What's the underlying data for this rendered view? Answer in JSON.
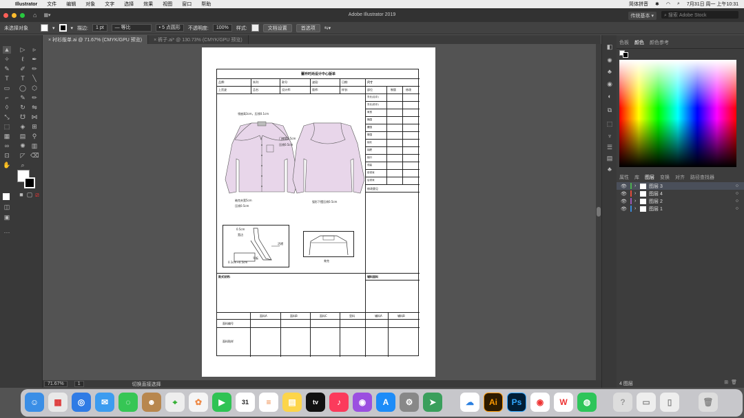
{
  "menubar": {
    "apple": "",
    "app": "Illustrator",
    "items": [
      "文件",
      "编辑",
      "对象",
      "文字",
      "选择",
      "效果",
      "视图",
      "窗口",
      "帮助"
    ],
    "input_method": "简体拼音",
    "clock": "7月31日 周一 上午10:31"
  },
  "titlebar": {
    "title": "Adobe Illustrator 2019",
    "workspace": "传统基本",
    "search_placeholder": "搜索 Adobe Stock"
  },
  "control": {
    "selection": "未选择对象",
    "stroke_label": "描边:",
    "stroke_value": "1 pt",
    "stroke_profile": "等比",
    "brush": "5 点圆形",
    "opacity_label": "不透明度:",
    "opacity_value": "100%",
    "style_label": "样式:",
    "doc_setup": "文档设置",
    "prefs": "首选项"
  },
  "tabs": [
    {
      "label": "衬衫版单.ai @ 71.67% (CMYK/GPU 预览)"
    },
    {
      "label": "裤子.ai* @ 130.73% (CMYK/GPU 预览)"
    }
  ],
  "status": {
    "zoom": "71.67%",
    "artboard": "1",
    "tool": "切换直接选择"
  },
  "panel": {
    "color_tabs": [
      "色板",
      "颜色",
      "颜色参考"
    ],
    "layer_tabs": [
      "属性",
      "库",
      "图层",
      "变换",
      "对齐",
      "路径查找器"
    ],
    "layers": [
      "图层 3",
      "图层 4",
      "图层 2",
      "图层 1"
    ],
    "layer_count": "4 图层",
    "layer_colors": [
      "#4caf50",
      "#e74c3c",
      "#9b59b6",
      "#3b8bd8"
    ]
  },
  "sheet": {
    "title": "蕾衿时尚设计中心版单",
    "r1": [
      "品牌:",
      "系列:",
      "款号:",
      "波段:",
      "日期:"
    ],
    "r2": [
      "上货波",
      "品名:",
      "设计师:",
      "版师:",
      "样衣:"
    ],
    "size_title": "尺寸",
    "size_head": [
      "部位",
      "制版",
      "修改"
    ],
    "size_rows": [
      "衣长(后中)",
      "衣长(前中)",
      "肩宽",
      "胸围",
      "腰围",
      "臀围",
      "袖长",
      "袖肥",
      "袖口",
      "领高",
      "前领深",
      "后领深"
    ],
    "modify": "修改意见",
    "ann1": "领座高3cm，压线0.1cm",
    "ann2": "门襟宽2.5cm",
    "ann3": "压线0.5cm",
    "ann4": "袖克夫宽5cm",
    "ann5": "压线0.5cm",
    "ann6": "弧形下摆压线0.5cm",
    "d1a": "0.5cm",
    "d1b": "宽边",
    "d1c": "活褶",
    "d1d": "平板",
    "d1e": "0.1cm+0.5cm",
    "d2": "育克",
    "style_note": "款式说明:",
    "fabric": "辅料面料",
    "mat_head": [
      "",
      "面料A",
      "面料B",
      "面料C",
      "里料",
      "辅料A",
      "辅料B"
    ],
    "mat_rows": [
      "面料编号",
      "面料贴样"
    ]
  }
}
